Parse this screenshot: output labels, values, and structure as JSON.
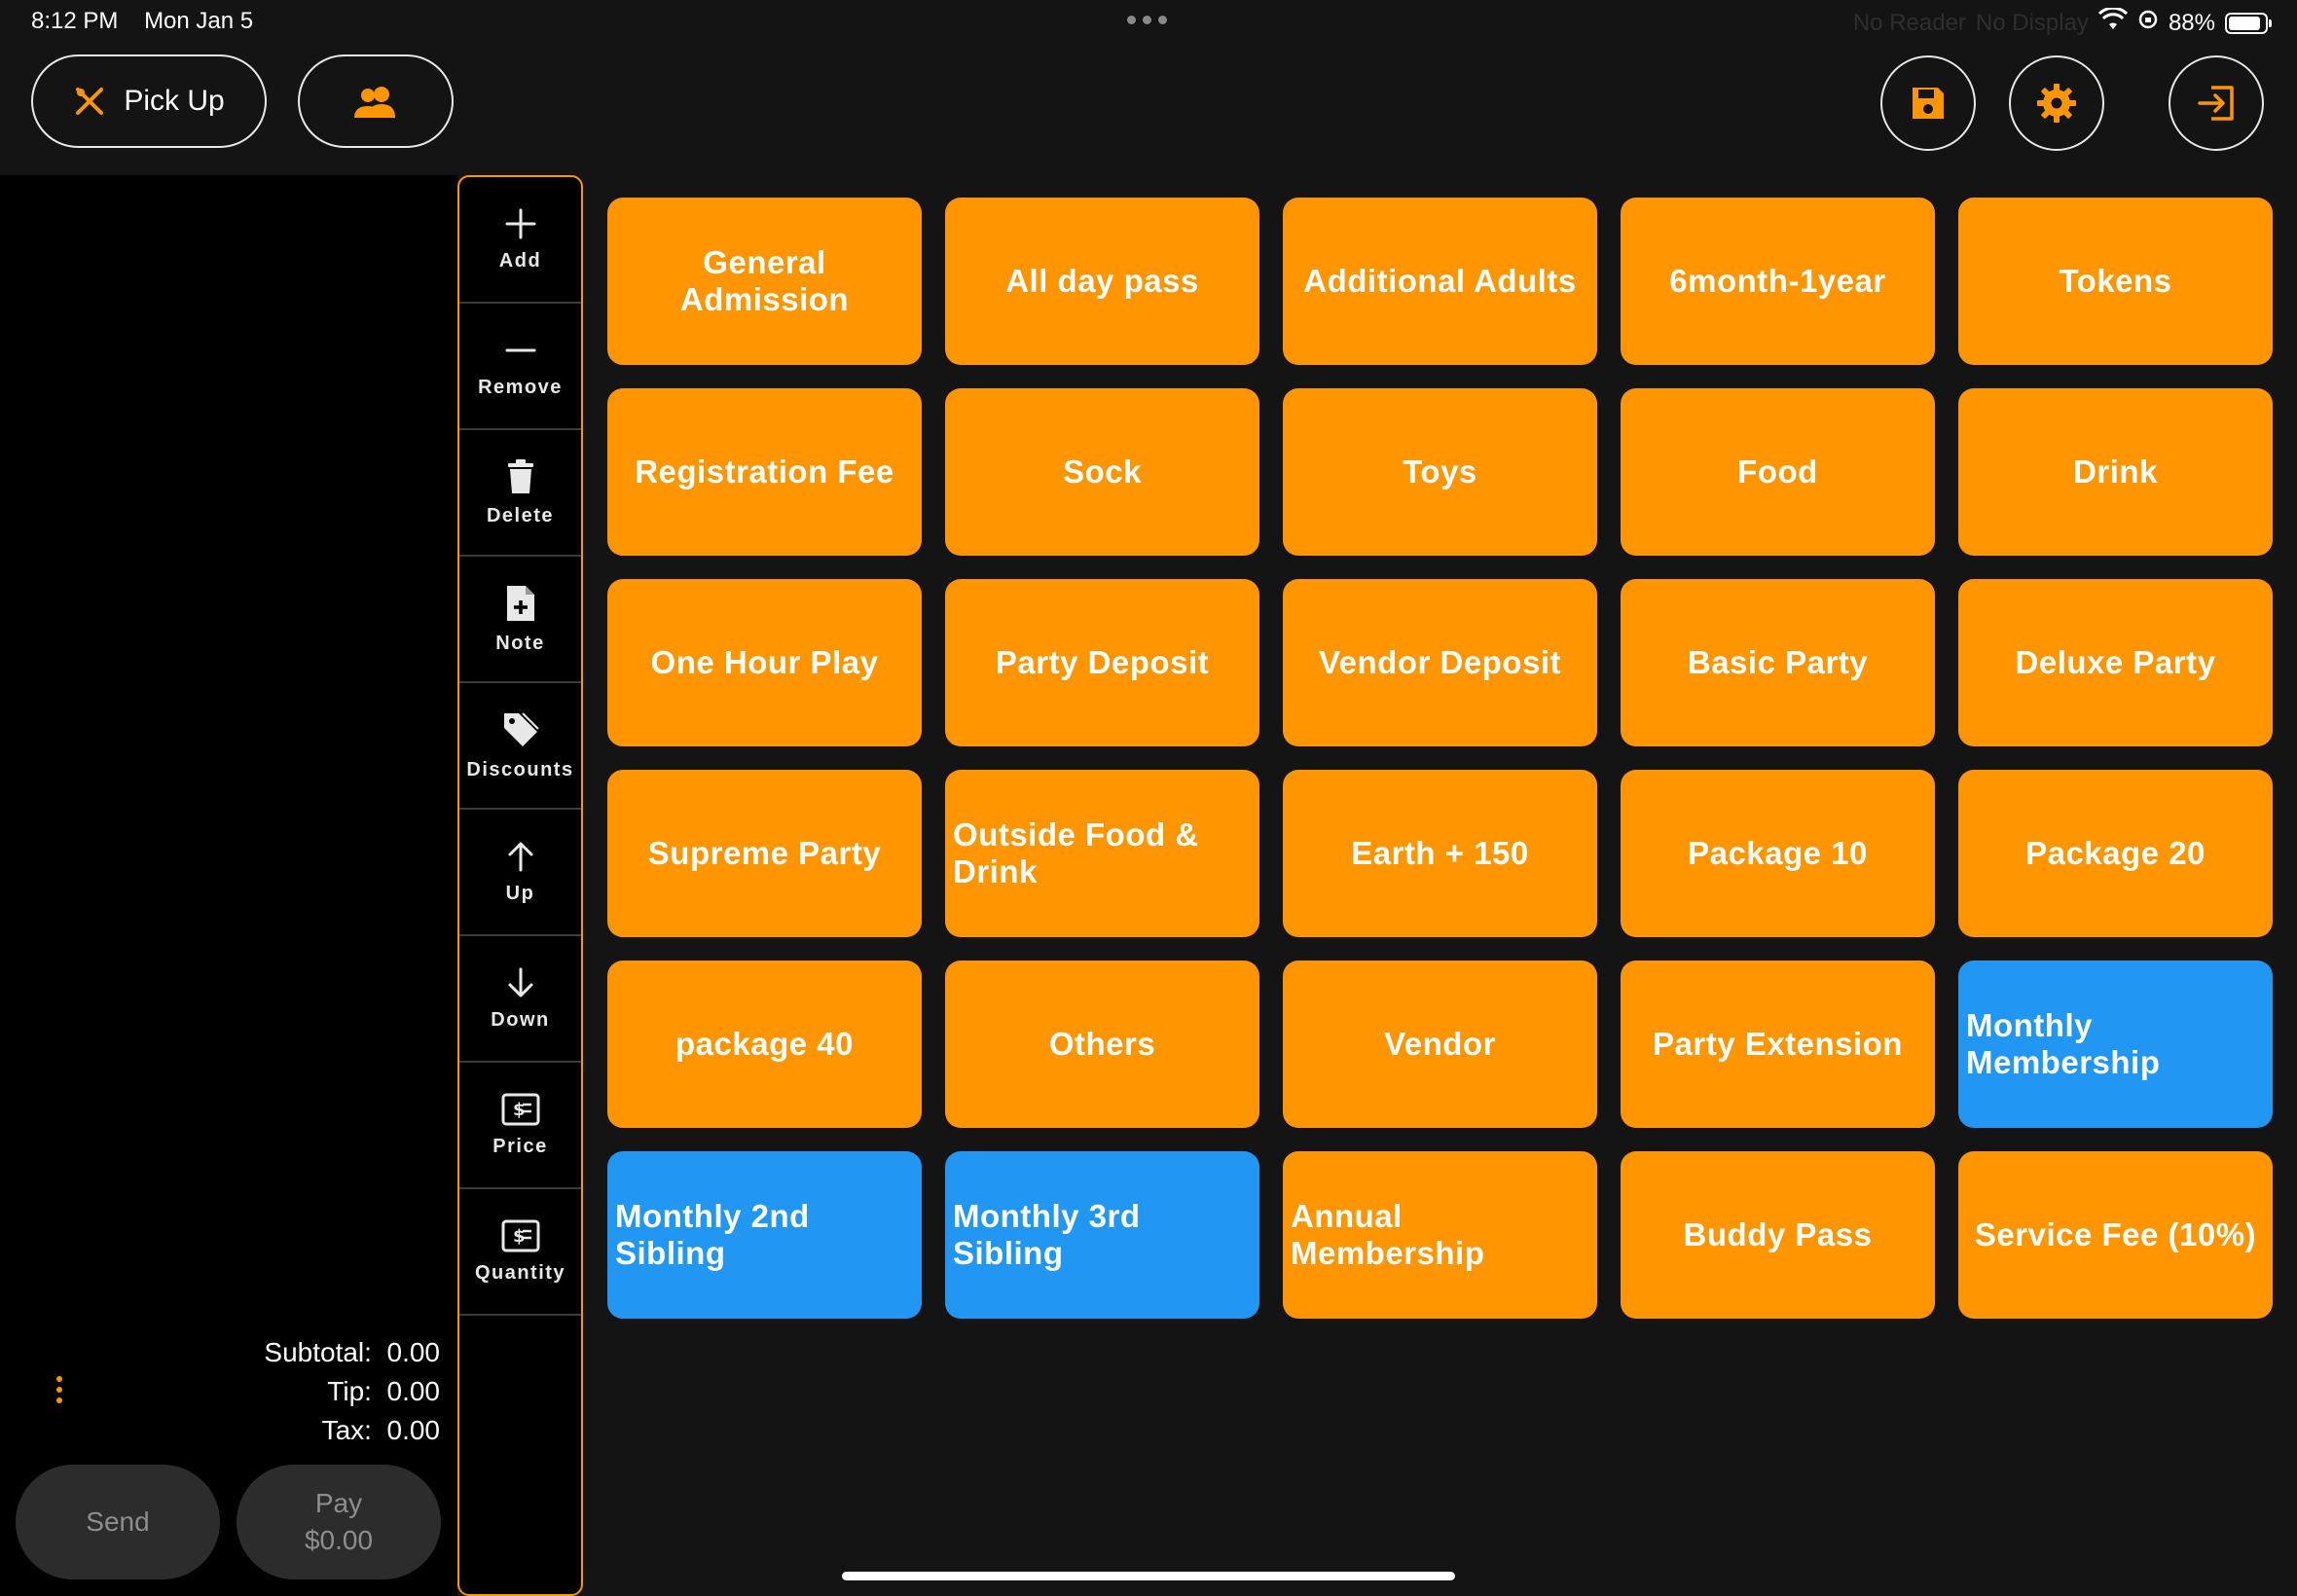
{
  "status_bar": {
    "time": "8:12 PM",
    "date": "Mon Jan 5",
    "reader": "No Reader",
    "display": "No Display",
    "battery": "88%"
  },
  "header": {
    "pickup_label": "Pick Up",
    "icons": [
      "fork-knife-icon",
      "users-icon",
      "save-icon",
      "gear-icon",
      "exit-icon"
    ]
  },
  "toolbar": {
    "items": [
      {
        "label": "Add",
        "icon": "plus-icon"
      },
      {
        "label": "Remove",
        "icon": "minus-icon"
      },
      {
        "label": "Delete",
        "icon": "trash-icon"
      },
      {
        "label": "Note",
        "icon": "note-icon"
      },
      {
        "label": "Discounts",
        "icon": "tag-icon"
      },
      {
        "label": "Up",
        "icon": "arrow-up-icon"
      },
      {
        "label": "Down",
        "icon": "arrow-down-icon"
      },
      {
        "label": "Price",
        "icon": "price-icon"
      },
      {
        "label": "Quantity",
        "icon": "quantity-icon"
      }
    ]
  },
  "order": {
    "subtotal_label": "Subtotal:",
    "subtotal": "0.00",
    "tip_label": "Tip:",
    "tip": "0.00",
    "tax_label": "Tax:",
    "tax": "0.00",
    "send_label": "Send",
    "pay_label": "Pay",
    "pay_amount": "$0.00"
  },
  "colors": {
    "accent": "#ff9500",
    "tile_orange": "#ff9500",
    "tile_blue": "#2196f3",
    "background": "#141414"
  },
  "products": [
    {
      "label": "General Admission",
      "color": "orange"
    },
    {
      "label": "All day pass",
      "color": "orange"
    },
    {
      "label": "Additional Adults",
      "color": "orange"
    },
    {
      "label": "6month-1year",
      "color": "orange"
    },
    {
      "label": "Tokens",
      "color": "orange"
    },
    {
      "label": "Registration Fee",
      "color": "orange"
    },
    {
      "label": "Sock",
      "color": "orange"
    },
    {
      "label": "Toys",
      "color": "orange"
    },
    {
      "label": "Food",
      "color": "orange"
    },
    {
      "label": "Drink",
      "color": "orange"
    },
    {
      "label": "One Hour Play",
      "color": "orange"
    },
    {
      "label": "Party Deposit",
      "color": "orange"
    },
    {
      "label": "Vendor Deposit",
      "color": "orange"
    },
    {
      "label": "Basic Party",
      "color": "orange"
    },
    {
      "label": "Deluxe Party",
      "color": "orange"
    },
    {
      "label": "Supreme Party",
      "color": "orange"
    },
    {
      "label": "Outside Food & Drink",
      "color": "orange",
      "align": "left"
    },
    {
      "label": "Earth + 150",
      "color": "orange"
    },
    {
      "label": "Package 10",
      "color": "orange"
    },
    {
      "label": "Package 20",
      "color": "orange"
    },
    {
      "label": "package 40",
      "color": "orange"
    },
    {
      "label": "Others",
      "color": "orange"
    },
    {
      "label": "Vendor",
      "color": "orange"
    },
    {
      "label": "Party Extension",
      "color": "orange"
    },
    {
      "label": "Monthly Membership",
      "color": "blue",
      "align": "left"
    },
    {
      "label": "Monthly 2nd Sibling",
      "color": "blue",
      "align": "left"
    },
    {
      "label": "Monthly 3rd Sibling",
      "color": "blue",
      "align": "left"
    },
    {
      "label": "Annual Membership",
      "color": "orange",
      "align": "left"
    },
    {
      "label": "Buddy Pass",
      "color": "orange"
    },
    {
      "label": "Service Fee (10%)",
      "color": "orange"
    }
  ]
}
